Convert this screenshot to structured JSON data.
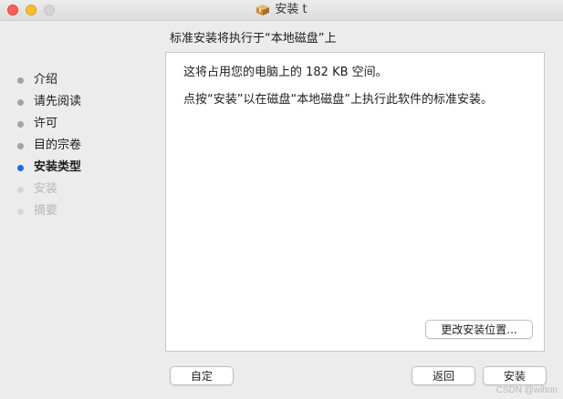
{
  "window": {
    "title": "安装 t"
  },
  "header": {
    "text": "标准安装将执行于“本地磁盘”上"
  },
  "sidebar": {
    "steps": [
      {
        "label": "介绍",
        "state": "done"
      },
      {
        "label": "请先阅读",
        "state": "done"
      },
      {
        "label": "许可",
        "state": "done"
      },
      {
        "label": "目的宗卷",
        "state": "done"
      },
      {
        "label": "安装类型",
        "state": "active"
      },
      {
        "label": "安装",
        "state": "future"
      },
      {
        "label": "摘要",
        "state": "future"
      }
    ]
  },
  "content": {
    "line1": "这将占用您的电脑上的 182 KB 空间。",
    "line2": "点按“安装”以在磁盘“本地磁盘”上执行此软件的标准安装。",
    "change_location_label": "更改安装位置..."
  },
  "footer": {
    "customize_label": "自定",
    "back_label": "返回",
    "install_label": "安装"
  },
  "watermark": "CSDN @witton",
  "colors": {
    "accent": "#1a6bdf",
    "close": "#fe5f57",
    "minimize": "#febc2e",
    "maximize": "#d4d4d4"
  },
  "icons": {
    "title": "package-icon"
  }
}
